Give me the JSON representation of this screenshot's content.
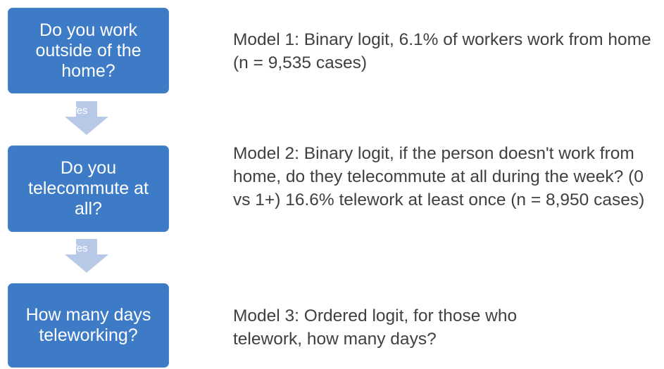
{
  "flowchart": {
    "steps": [
      {
        "question": "Do you work outside of the home?",
        "description": "Model 1: Binary logit, 6.1% of workers work from home (n = 9,535 cases)"
      },
      {
        "question": "Do you telecommute at all?",
        "description": "Model 2: Binary logit, if the person doesn't work from home, do they telecommute at all during the week? (0 vs 1+) 16.6% telework at least once (n = 8,950 cases)"
      },
      {
        "question": "How many days teleworking?",
        "description": "Model 3: Ordered logit, for those who telework, how many days?"
      }
    ],
    "connectors": [
      {
        "label": "Yes"
      },
      {
        "label": "Yes"
      }
    ]
  },
  "colors": {
    "box_fill": "#3e7bc7",
    "arrow_fill": "#b7c9e6",
    "description_text": "#404040"
  }
}
